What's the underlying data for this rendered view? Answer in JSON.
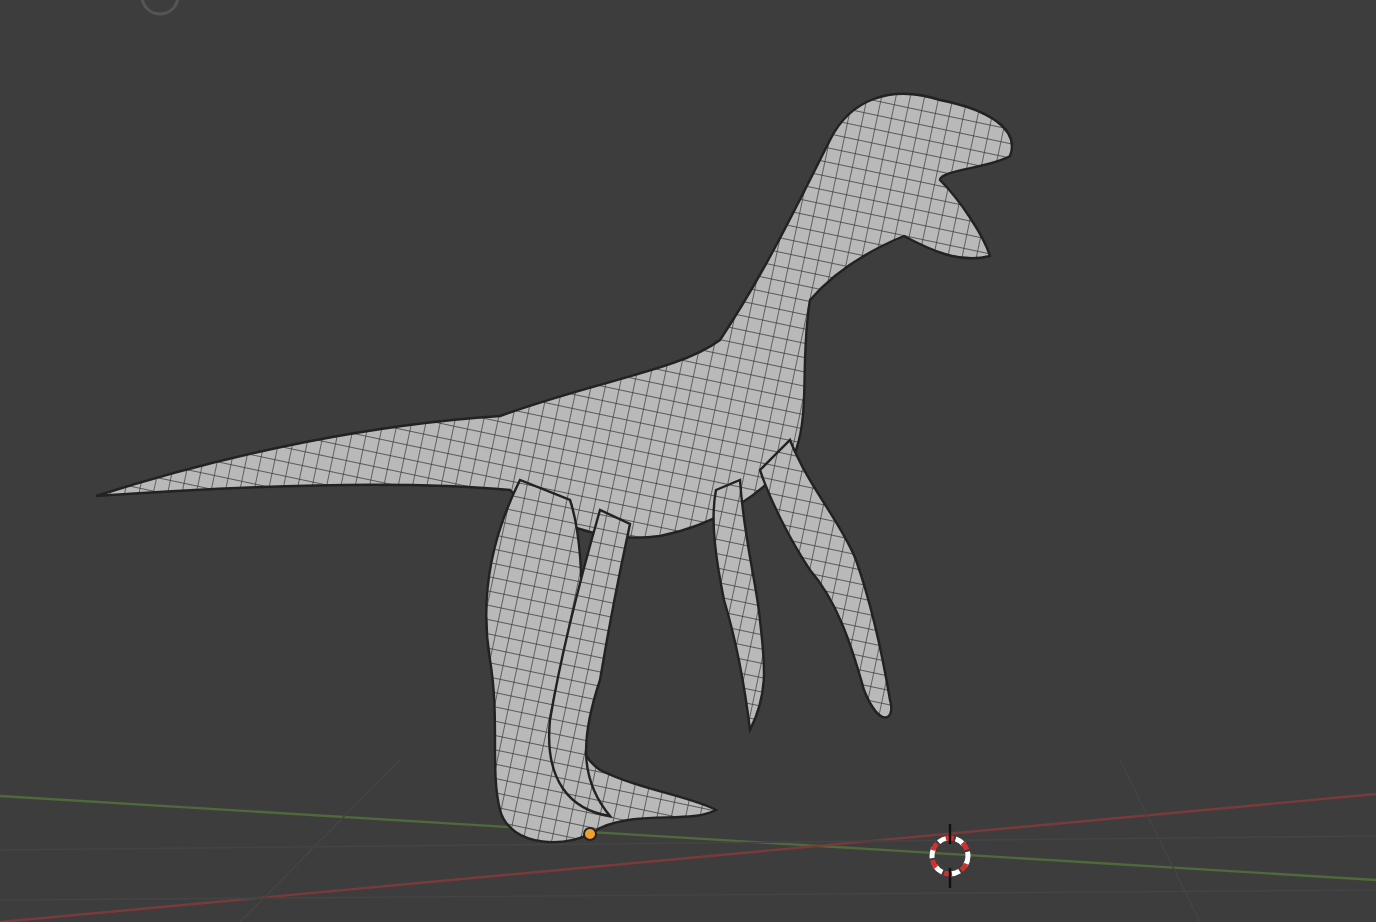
{
  "viewport": {
    "show_floor_grid": true,
    "show_origin": true
  }
}
